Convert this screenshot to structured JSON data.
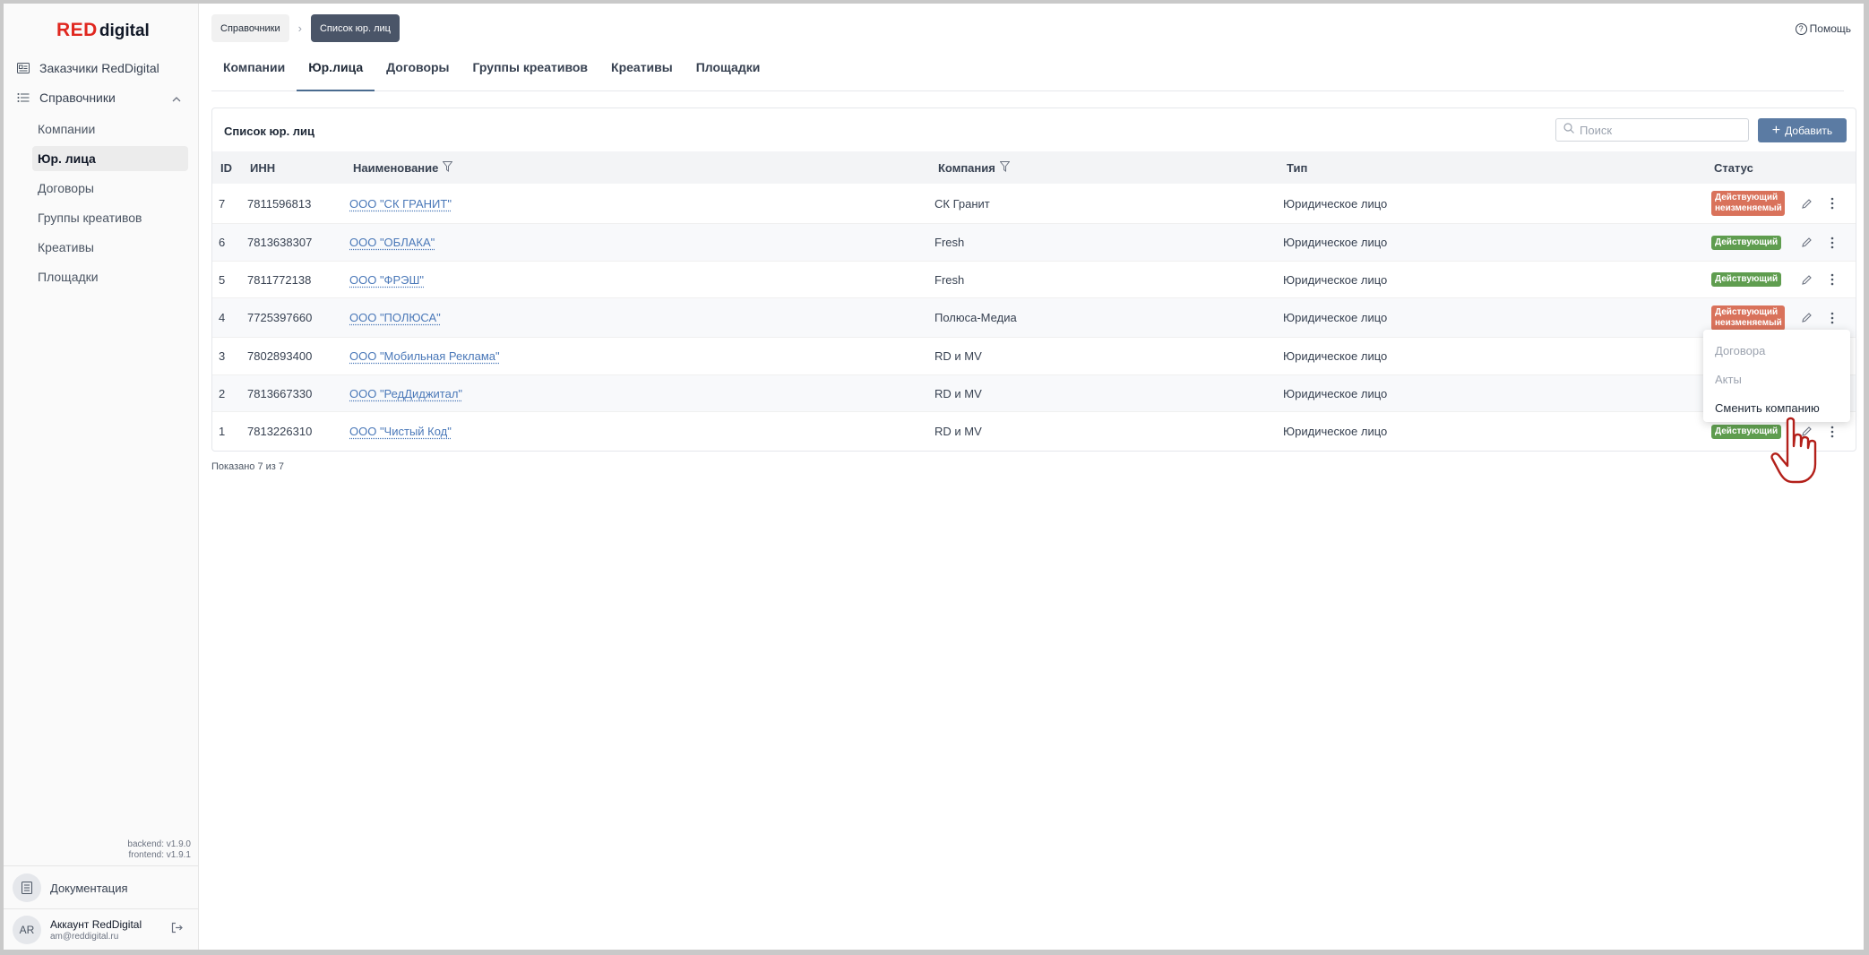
{
  "app": {
    "logo_red": "RED",
    "logo_digital": "digital"
  },
  "sidebar": {
    "customers": "Заказчики RedDigital",
    "directories": "Справочники",
    "items": [
      {
        "label": "Компании"
      },
      {
        "label": "Юр. лица"
      },
      {
        "label": "Договоры"
      },
      {
        "label": "Группы креативов"
      },
      {
        "label": "Креативы"
      },
      {
        "label": "Площадки"
      }
    ],
    "backend_version": "backend: v1.9.0",
    "frontend_version": "frontend: v1.9.1",
    "documentation": "Документация",
    "account_initials": "AR",
    "account_name": "Аккаунт RedDigital",
    "account_email": "am@reddigital.ru"
  },
  "breadcrumbs": {
    "parent": "Справочники",
    "current": "Список юр. лиц"
  },
  "help": "Помощь",
  "tabs": [
    {
      "label": "Компании"
    },
    {
      "label": "Юр.лица"
    },
    {
      "label": "Договоры"
    },
    {
      "label": "Группы креативов"
    },
    {
      "label": "Креативы"
    },
    {
      "label": "Площадки"
    }
  ],
  "card": {
    "title": "Список юр. лиц",
    "search_placeholder": "Поиск",
    "add_label": "Добавить"
  },
  "table": {
    "headers": {
      "id": "ID",
      "inn": "ИНН",
      "name": "Наименование",
      "company": "Компания",
      "type": "Тип",
      "status": "Статус"
    },
    "rows": [
      {
        "id": "7",
        "inn": "7811596813",
        "name": "ООО \"СК ГРАНИТ\"",
        "company": "СК Гранит",
        "type": "Юридическое лицо",
        "status": "Действующий неизменяемый"
      },
      {
        "id": "6",
        "inn": "7813638307",
        "name": "ООО \"ОБЛАКА\"",
        "company": "Fresh",
        "type": "Юридическое лицо",
        "status": "Действующий"
      },
      {
        "id": "5",
        "inn": "7811772138",
        "name": "ООО \"ФРЭШ\"",
        "company": "Fresh",
        "type": "Юридическое лицо",
        "status": "Действующий"
      },
      {
        "id": "4",
        "inn": "7725397660",
        "name": "ООО \"ПОЛЮСА\"",
        "company": "Полюса-Медиа",
        "type": "Юридическое лицо",
        "status": "Действующий неизменяемый"
      },
      {
        "id": "3",
        "inn": "7802893400",
        "name": "ООО \"Мобильная Реклама\"",
        "company": "RD и MV",
        "type": "Юридическое лицо",
        "status": ""
      },
      {
        "id": "2",
        "inn": "7813667330",
        "name": "ООО \"РедДиджитал\"",
        "company": "RD и MV",
        "type": "Юридическое лицо",
        "status": ""
      },
      {
        "id": "1",
        "inn": "7813226310",
        "name": "ООО \"Чистый Код\"",
        "company": "RD и MV",
        "type": "Юридическое лицо",
        "status": "Действующий"
      }
    ],
    "shown": "Показано 7 из 7"
  },
  "context_menu": {
    "items": [
      {
        "label": "Договора"
      },
      {
        "label": "Акты"
      },
      {
        "label": "Сменить компанию"
      }
    ]
  },
  "colors": {
    "brand_red": "#e0271f",
    "accent": "#5b7ba3",
    "status_active": "#5f9d4f",
    "status_immutable": "#d9725b",
    "link": "#4a78b8"
  }
}
